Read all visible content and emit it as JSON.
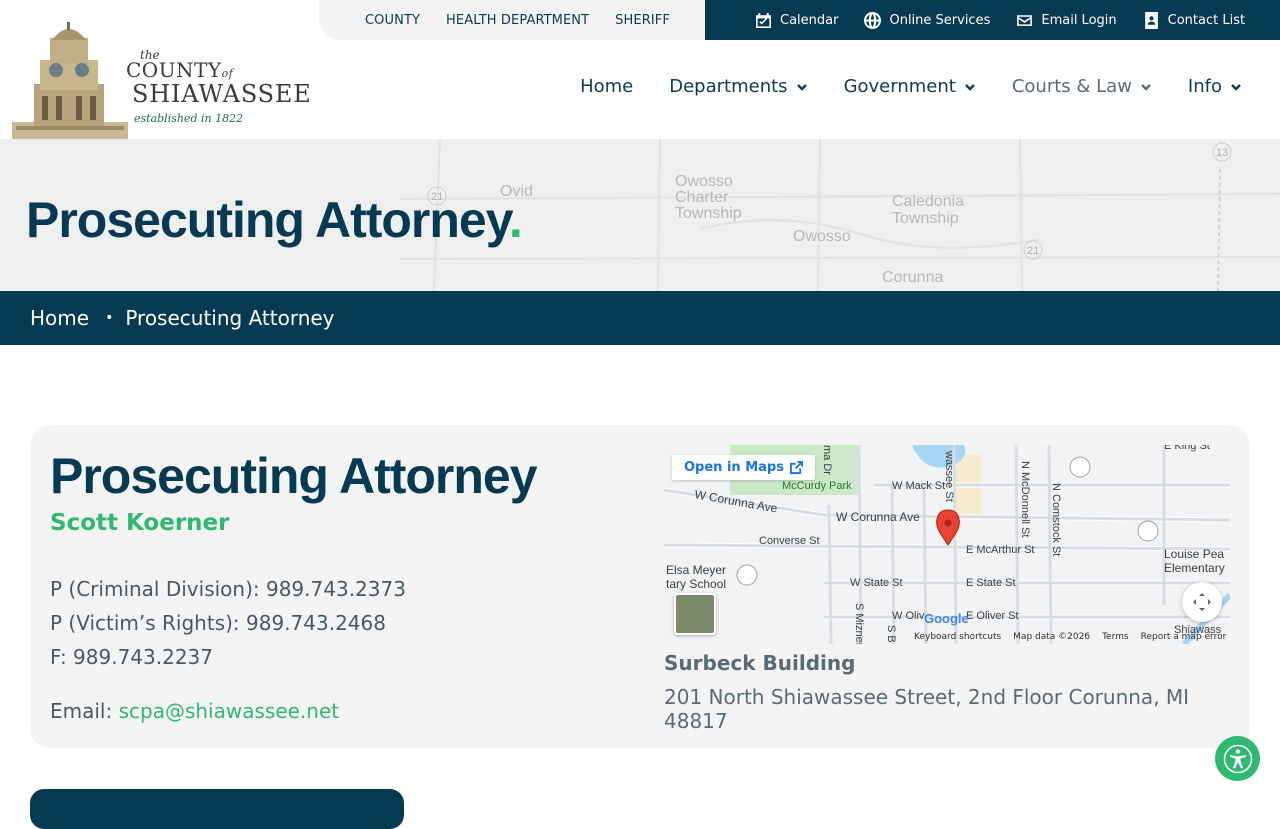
{
  "utility_nav": {
    "left_links": [
      "COUNTY",
      "HEALTH DEPARTMENT",
      "SHERIFF"
    ],
    "right_links": [
      {
        "label": "Calendar",
        "icon": "calendar-icon"
      },
      {
        "label": "Online Services",
        "icon": "globe-icon"
      },
      {
        "label": "Email Login",
        "icon": "mail-icon"
      },
      {
        "label": "Contact List",
        "icon": "contact-book-icon"
      }
    ]
  },
  "logo": {
    "the": "the",
    "county": "COUNTY",
    "of": "of",
    "name": "SHIAWASSEE",
    "established": "established in 1822"
  },
  "main_nav": [
    "Home",
    "Departments",
    "Government",
    "Courts & Law",
    "Info"
  ],
  "hero": {
    "title": "Prosecuting Attorney",
    "title_dot": ".",
    "map_labels": [
      "Ovid",
      "Owosso Charter Township",
      "Caledonia Township",
      "Owosso",
      "Corunna",
      "21",
      "13"
    ]
  },
  "breadcrumb": [
    "Home",
    "Prosecuting Attorney"
  ],
  "office": {
    "title": "Prosecuting Attorney",
    "person": "Scott Koerner",
    "phone_criminal": "P (Criminal Division): 989.743.2373",
    "phone_victim": "P (Victim’s Rights): 989.743.2468",
    "fax": "F: 989.743.2237",
    "email_label": "Email: ",
    "email": "scpa@shiawassee.net",
    "building": "Surbeck Building",
    "address": "201 North Shiawassee Street, 2nd Floor Corunna, MI 48817"
  },
  "map": {
    "open_label": "Open in Maps",
    "streets": [
      "McCurdy Park",
      "W Mack St",
      "W Corunna Ave",
      "W Corunna Ave",
      "Converse St",
      "E McArthur St",
      "W State St",
      "E State St",
      "E Oliver St",
      "W Oliv",
      "N McDonnell St",
      "N Comstock St",
      "E King St",
      "Louise Pea",
      "Elementary",
      "Elsa Meyer",
      "tary School",
      "Shiawass",
      "S Mizner",
      "S B",
      "wassee St",
      "ma Dr"
    ],
    "footer": [
      "Keyboard shortcuts",
      "Map data ©2026",
      "Terms",
      "Report a map error"
    ]
  },
  "colors": {
    "navy": "#063a52",
    "green": "#2eb872",
    "card_bg": "#f4f4f4"
  }
}
